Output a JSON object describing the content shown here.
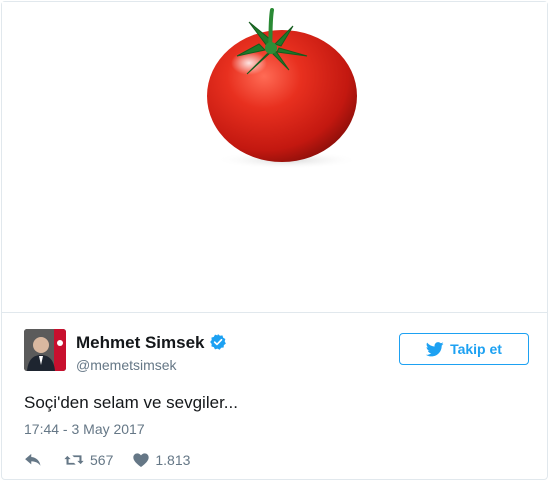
{
  "tweet": {
    "author_name": "Mehmet Simsek",
    "author_handle": "@memetsimsek",
    "follow_label": "Takip et",
    "text": "Soçi'den selam ve sevgiler...",
    "timestamp": "17:44 - 3 May 2017",
    "retweet_count": "567",
    "like_count": "1.813"
  },
  "icons": {
    "verified": "verified-badge-icon",
    "twitter_bird": "twitter-bird-icon",
    "reply": "reply-icon",
    "retweet": "retweet-icon",
    "like": "heart-icon"
  },
  "colors": {
    "accent": "#1da1f2",
    "text": "#14171a",
    "muted": "#657786",
    "border": "#e1e8ed",
    "tomato": "#e3261d"
  }
}
